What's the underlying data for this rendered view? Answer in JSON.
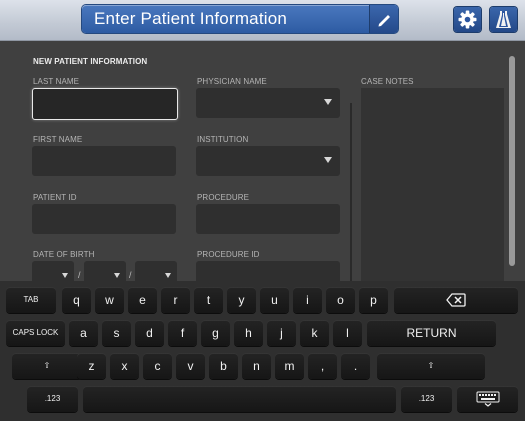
{
  "header": {
    "title": "Enter Patient Information",
    "edit_icon": "pencil-icon",
    "settings_icon": "gear-icon",
    "logo_icon": "brand-logo-icon"
  },
  "form": {
    "section_title": "NEW PATIENT INFORMATION",
    "fields": {
      "last_name": "LAST NAME",
      "first_name": "FIRST NAME",
      "patient_id": "PATIENT ID",
      "date_of_birth": "DATE OF BIRTH",
      "date_separator": "/",
      "physician_name": "PHYSICIAN NAME",
      "institution": "INSTITUTION",
      "procedure": "PROCEDURE",
      "procedure_id": "PROCEDURE ID",
      "case_notes": "CASE NOTES"
    }
  },
  "keyboard": {
    "row1": [
      "TAB",
      "q",
      "w",
      "e",
      "r",
      "t",
      "y",
      "u",
      "i",
      "o",
      "p"
    ],
    "row2": [
      "CAPS LOCK",
      "a",
      "s",
      "d",
      "f",
      "g",
      "h",
      "j",
      "k",
      "l",
      "RETURN"
    ],
    "row3": [
      "⇧",
      "z",
      "x",
      "c",
      "v",
      "b",
      "n",
      "m",
      ",",
      ".",
      "⇧"
    ],
    "row4": [
      ".123",
      ".123"
    ],
    "backspace_icon": "backspace-icon",
    "hide_keyboard_icon": "hide-keyboard-icon"
  }
}
